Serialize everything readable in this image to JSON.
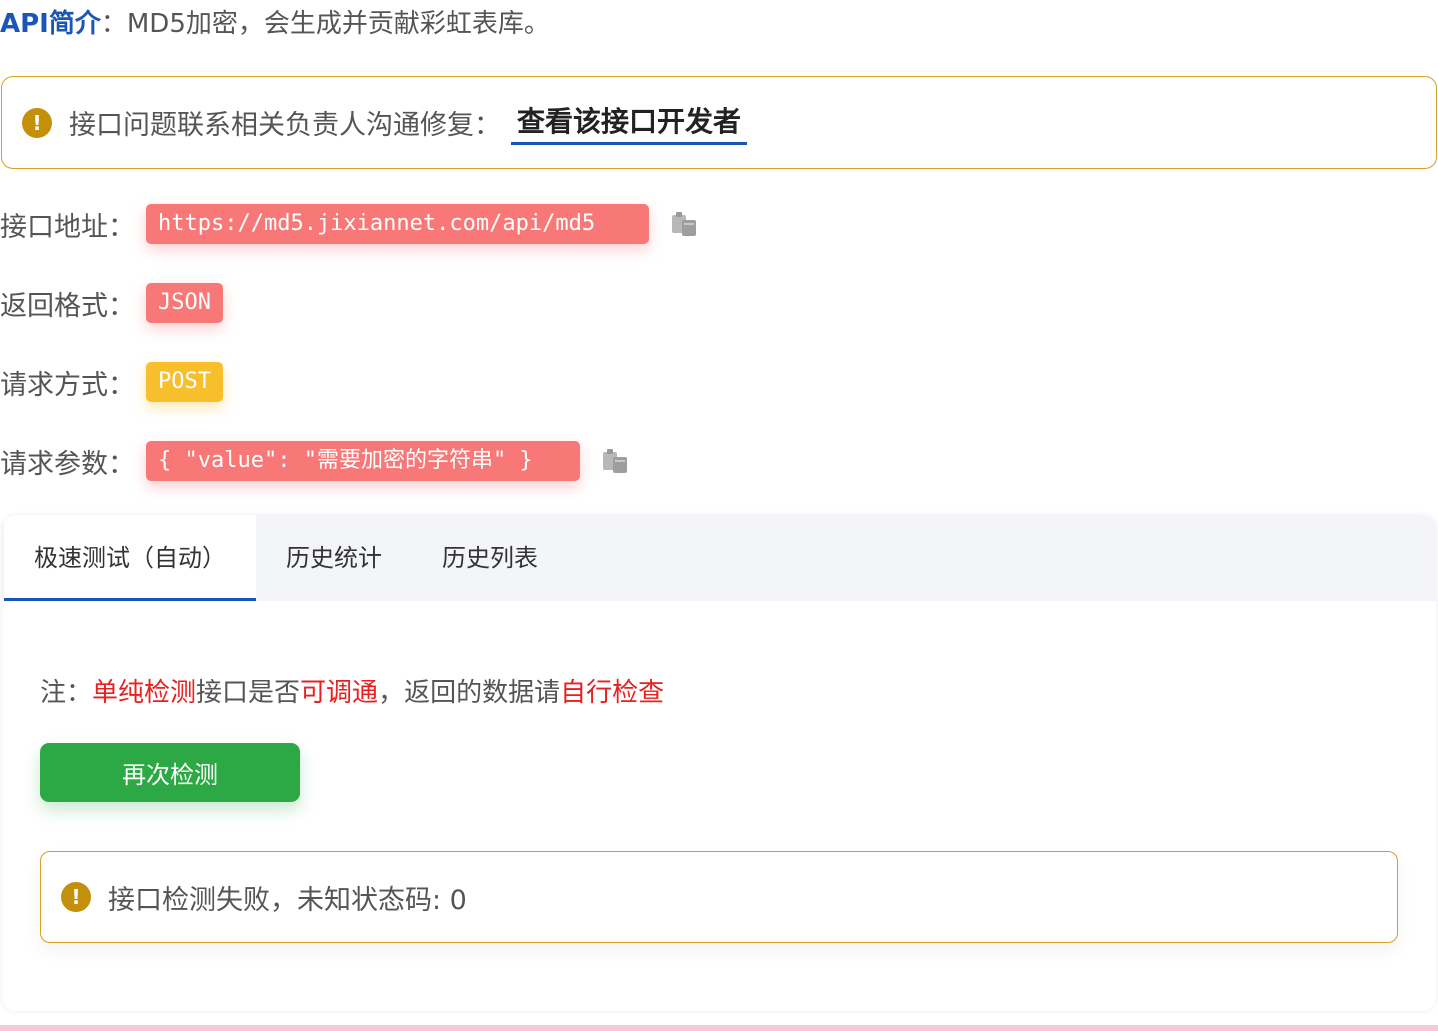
{
  "intro": {
    "label": "API简介",
    "text": "：MD5加密，会生成并贡献彩虹表库。"
  },
  "notice": {
    "icon": "exclamation-circle-icon",
    "text": "接口问题联系相关负责人沟通修复：",
    "link_label": "查看该接口开发者"
  },
  "info": {
    "address": {
      "label": "接口地址：",
      "value": "https://md5.jixiannet.com/api/md5",
      "copy_icon": "copy-icon"
    },
    "format": {
      "label": "返回格式：",
      "value": "JSON"
    },
    "method": {
      "label": "请求方式：",
      "value": "POST"
    },
    "params": {
      "label": "请求参数：",
      "value": "{ \"value\": \"需要加密的字符串\" }",
      "copy_icon": "copy-icon"
    }
  },
  "tabs": [
    {
      "label": "极速测试（自动）",
      "active": true
    },
    {
      "label": "历史统计",
      "active": false
    },
    {
      "label": "历史列表",
      "active": false
    }
  ],
  "test": {
    "note_prefix": "注：",
    "note_hl1": "单纯检测",
    "note_mid1": "接口是否",
    "note_hl2": "可调通",
    "note_mid2": "，返回的数据请",
    "note_hl3": "自行检查",
    "button_label": "再次检测",
    "result_text": "接口检测失败，未知状态码: 0"
  },
  "colors": {
    "accent_blue": "#1a56b8",
    "warning_border": "#d4a020",
    "tag_red": "#f87878",
    "tag_yellow": "#f8bf2c",
    "button_green": "#2ca844",
    "highlight_red": "#e82020"
  }
}
